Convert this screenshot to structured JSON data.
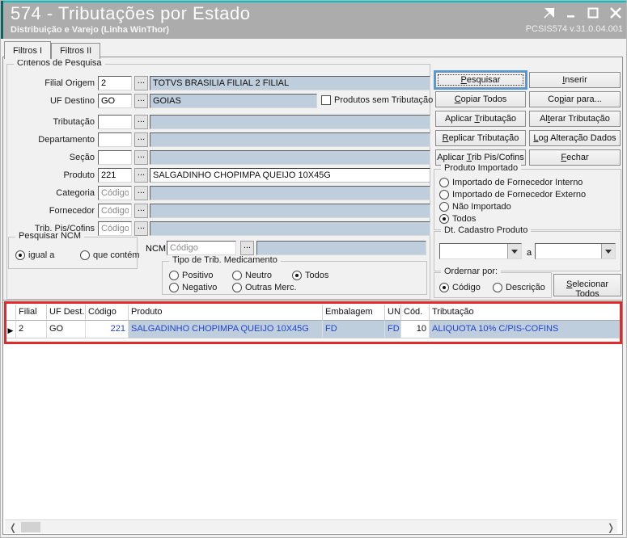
{
  "window": {
    "title": "574 - Tributações por Estado",
    "subtitle": "Distribuição e Varejo (Linha WinThor)",
    "version": "PCSIS574  v.31.0.04.001"
  },
  "tabs": {
    "items": [
      "Filtros I",
      "Filtros II"
    ],
    "active": "Filtros I"
  },
  "criteria": {
    "group_label": "Critérios de Pesquisa",
    "no_trib_checkbox": {
      "label": "Produtos sem Tributação",
      "checked": false
    },
    "rows": [
      {
        "label": "Filial Origem",
        "value": "2",
        "placeholder": "",
        "display": "TOTVS BRASILIA FILIAL 2 FILIAL"
      },
      {
        "label": "UF Destino",
        "value": "GO",
        "placeholder": "",
        "display": "GOIAS"
      },
      {
        "label": "Tributação",
        "value": "",
        "placeholder": "",
        "display": ""
      },
      {
        "label": "Departamento",
        "value": "",
        "placeholder": "",
        "display": ""
      },
      {
        "label": "Seção",
        "value": "",
        "placeholder": "",
        "display": ""
      },
      {
        "label": "Produto",
        "value": "221",
        "placeholder": "",
        "display": "SALGADINHO CHOPIMPA QUEIJO 10X45G"
      },
      {
        "label": "Categoria",
        "value": "",
        "placeholder": "Código",
        "display": ""
      },
      {
        "label": "Fornecedor",
        "value": "",
        "placeholder": "Código",
        "display": ""
      },
      {
        "label": "Trib. Pis/Cofins",
        "value": "",
        "placeholder": "Código",
        "display": ""
      }
    ]
  },
  "ncm": {
    "group_label": "Pesquisar NCM",
    "options": [
      "igual a",
      "que contém"
    ],
    "selected": "igual a",
    "field_label": "NCM",
    "placeholder": "Código"
  },
  "medicamento": {
    "group_label": "Tipo de Trib. Medicamento",
    "options": [
      "Positivo",
      "Neutro",
      "Todos",
      "Negativo",
      "Outras Merc."
    ],
    "selected": "Todos"
  },
  "actions": {
    "pesquisar": "Pesquisar",
    "inserir": "Inserir",
    "copiar_todos": "Copiar Todos",
    "copiar_para": "Copiar para...",
    "aplicar_tributacao": "Aplicar Tributação",
    "alterar_tributacao": "Alterar Tributação",
    "replicar_tributacao": "Replicar Tributação",
    "log_alteracao": "Log Alteração Dados",
    "aplicar_trib_pis": "Aplicar Trib Pis/Cofins",
    "fechar": "Fechar"
  },
  "imported": {
    "group_label": "Produto Importado",
    "options": [
      "Importado de Fornecedor Interno",
      "Importado de Fornecedor Externo",
      "Não Importado",
      "Todos"
    ],
    "selected": "Todos"
  },
  "dt_cadastro": {
    "group_label": "Dt. Cadastro Produto",
    "separator": "a",
    "from": "",
    "to": ""
  },
  "ordenar": {
    "group_label": "Ordernar por:",
    "options": [
      "Código",
      "Descrição"
    ],
    "selected": "Código",
    "select_all": "Selecionar Todos"
  },
  "grid": {
    "columns": [
      "Filial",
      "UF Dest.",
      "Código",
      "Produto",
      "Embalagem",
      "UN",
      "Cód.",
      "Tributação"
    ],
    "row": {
      "filial": "2",
      "uf_dest": "GO",
      "codigo": "221",
      "produto": "SALGADINHO CHOPIMPA QUEIJO 10X45G",
      "embalagem": "FD",
      "un": "FD",
      "cod": "10",
      "tributacao": "ALIQUOTA 10% C/PIS-COFINS"
    }
  },
  "colors": {
    "titlebar": "#acacac",
    "teal_accent": "#00c4c4",
    "field_blue": "#bfcedd",
    "grid_blue_text": "#2244cc",
    "highlight_red": "#e12b2b"
  }
}
